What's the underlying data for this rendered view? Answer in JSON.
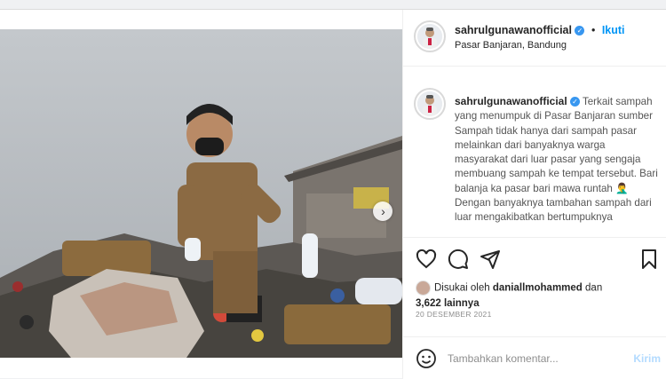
{
  "post": {
    "username": "sahrulgunawanofficial",
    "follow_label": "Ikuti",
    "dot": "•",
    "location": "Pasar Banjaran, Bandung",
    "caption_lines": [
      "Terkait sampah yang menumpuk di Pasar Banjaran sumber Sampah tidak hanya dari sampah pasar melainkan dari banyaknya warga masyarakat dari luar pasar yang sengaja membuang sampah ke tempat tersebut. Bari balanja ka pasar bari mawa runtah 🤦‍♂️",
      "Dengan banyaknya tambahan sampah dari luar mengakibatkan bertumpuknya"
    ],
    "liked_by_prefix": "Disukai oleh",
    "liked_by_user": "daniallmohammed",
    "liked_by_and": "dan",
    "others_count": "3,622 lainnya",
    "date": "20 DESEMBER 2021",
    "comment_placeholder": "Tambahkan komentar...",
    "post_button": "Kirim",
    "next_icon": "chevron-right-icon"
  },
  "colors": {
    "accent": "#0095f6",
    "verified": "#3897f0",
    "muted": "#8e8e8e"
  }
}
